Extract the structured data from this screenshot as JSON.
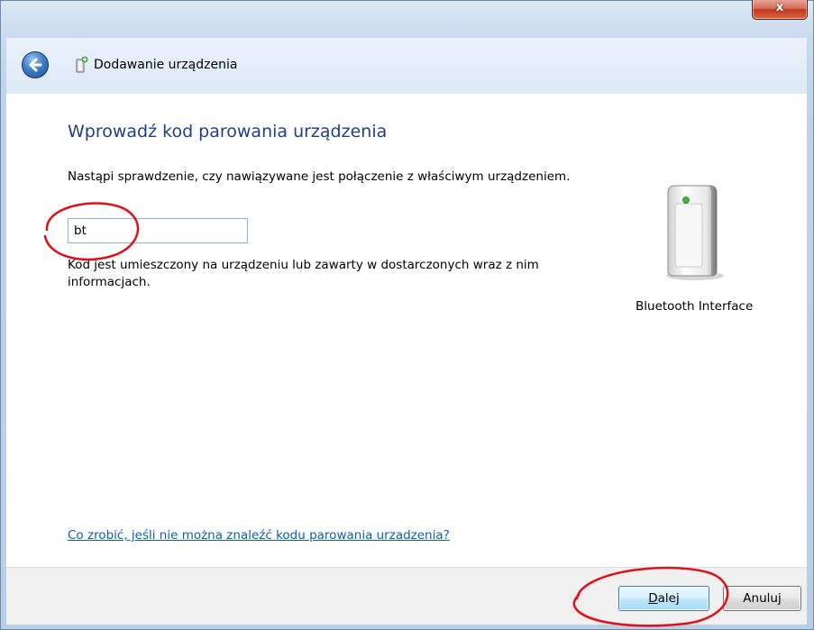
{
  "window": {
    "close_symbol": "x"
  },
  "header": {
    "title": "Dodawanie urządzenia",
    "back_icon": "back-arrow-icon",
    "device_icon": "add-device-icon"
  },
  "main": {
    "heading": "Wprowadź kod parowania urządzenia",
    "description": "Nastąpi sprawdzenie, czy nawiązywane jest połączenie z właściwym urządzeniem.",
    "code_input_value": "bt",
    "hint": "Kod jest umieszczony na urządzeniu lub zawarty w dostarczonych wraz z nim informacjach.",
    "device_label": "Bluetooth Interface",
    "help_link": "Co zrobić, jeśli nie można znaleźć kodu parowania urzadzenia?"
  },
  "footer": {
    "next_mnemonic": "D",
    "next_rest": "alej",
    "cancel_label": "Anuluj"
  },
  "colors": {
    "heading": "#1e3f8c",
    "link": "#0b5fb4",
    "annotation": "#e0101a"
  }
}
